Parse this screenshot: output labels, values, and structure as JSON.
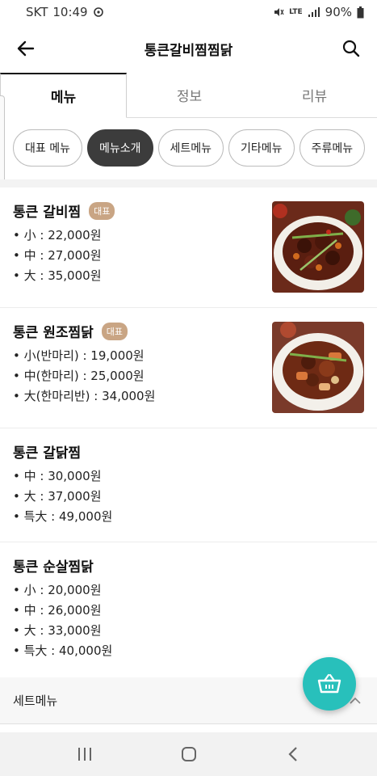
{
  "status_bar": {
    "carrier": "SKT",
    "time": "10:49",
    "network": "LTE",
    "battery": "90%"
  },
  "header": {
    "title": "통큰갈비찜찜닭"
  },
  "tabs": [
    {
      "label": "메뉴",
      "active": true
    },
    {
      "label": "정보",
      "active": false
    },
    {
      "label": "리뷰",
      "active": false
    }
  ],
  "categories": [
    {
      "label": "대표 메뉴",
      "active": false
    },
    {
      "label": "메뉴소개",
      "active": true
    },
    {
      "label": "세트메뉴",
      "active": false
    },
    {
      "label": "기타메뉴",
      "active": false
    },
    {
      "label": "주류메뉴",
      "active": false
    }
  ],
  "menu_items": [
    {
      "name": "통큰 갈비찜",
      "badge": "대표",
      "prices": [
        "• 小 : 22,000원",
        "• 中 : 27,000원",
        "• 大 : 35,000원"
      ],
      "image": "galbijjim-photo"
    },
    {
      "name": "통큰 원조찜닭",
      "badge": "대표",
      "prices": [
        "• 小(반마리) : 19,000원",
        "• 中(한마리) : 25,000원",
        "• 大(한마리반) : 34,000원"
      ],
      "image": "jjimdak-photo"
    },
    {
      "name": "통큰 갈닭찜",
      "badge": "",
      "prices": [
        "• 中 : 30,000원",
        "• 大 : 37,000원",
        "• 특大 : 49,000원"
      ]
    },
    {
      "name": "통큰 순살찜닭",
      "badge": "",
      "prices": [
        "• 小 : 20,000원",
        "• 中 : 26,000원",
        "• 大 : 33,000원",
        "• 특大 : 40,000원"
      ]
    }
  ],
  "sections": {
    "set_menu_label": "세트메뉴"
  },
  "colors": {
    "accent": "#28c0bb",
    "badge": "#c9a584",
    "active_chip": "#3c3c3c"
  }
}
